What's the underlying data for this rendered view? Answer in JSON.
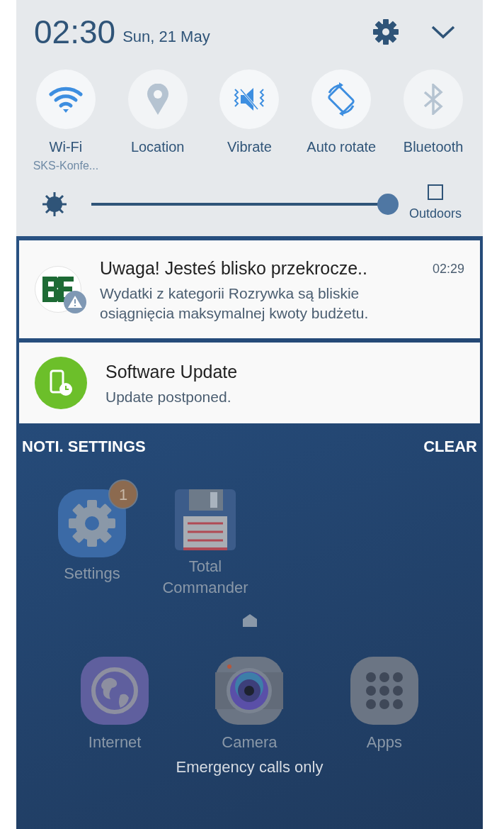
{
  "status": {
    "time": "02:30",
    "date": "Sun, 21 May"
  },
  "toggles": [
    {
      "kind": "wifi",
      "label": "Wi-Fi",
      "sublabel": "SKS-Konfe...",
      "on": true
    },
    {
      "kind": "location",
      "label": "Location",
      "on": false
    },
    {
      "kind": "vibrate",
      "label": "Vibrate",
      "on": true
    },
    {
      "kind": "rotate",
      "label": "Auto rotate",
      "on": true
    },
    {
      "kind": "bluetooth",
      "label": "Bluetooth",
      "on": false
    }
  ],
  "brightness": {
    "level": 1.0,
    "outdoors": {
      "label": "Outdoors",
      "checked": false
    }
  },
  "notifications": [
    {
      "kind": "budget",
      "title": "Uwaga! Jesteś blisko przekrocze..",
      "time": "02:29",
      "text": "Wydatki z kategorii Rozrywka są bliskie osiągnięcia maksymalnej kwoty budżetu."
    },
    {
      "kind": "update",
      "title": "Software Update",
      "text": "Update postponed."
    }
  ],
  "actions": {
    "left": "NOTI. SETTINGS",
    "right": "CLEAR"
  },
  "home_apps": [
    {
      "kind": "settings",
      "label": "Settings",
      "badge": "1"
    },
    {
      "kind": "floppy",
      "label": "Total Commander"
    }
  ],
  "dock_apps": [
    {
      "kind": "globe",
      "label": "Internet"
    },
    {
      "kind": "camera",
      "label": "Camera"
    },
    {
      "kind": "grid",
      "label": "Apps"
    }
  ],
  "footer": "Emergency calls only"
}
